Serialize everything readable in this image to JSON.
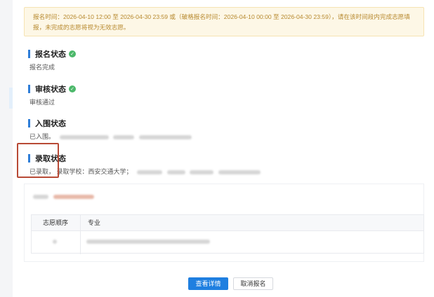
{
  "notice": {
    "text": "报名时间：2026-04-10 12:00 至 2026-04-30 23:59 或（破格报名时间：2026-04-10 00:00 至 2026-04-30 23:59），请在该时间段内完成志愿填报，未完成的志愿将视为无效志愿。"
  },
  "sections": {
    "registration": {
      "title": "报名状态",
      "status": "报名完成"
    },
    "review": {
      "title": "审核状态",
      "status": "审核通过"
    },
    "shortlist": {
      "title": "入围状态",
      "status": "已入围。"
    },
    "admission": {
      "title": "录取状态",
      "status_prefix": "已录取，",
      "school_label": "录取学校：西安交通大学；"
    }
  },
  "table": {
    "headers": [
      "志愿顺序",
      "专业"
    ]
  },
  "buttons": {
    "view_details": "查看详情",
    "cancel_registration": "取消报名"
  },
  "colors": {
    "accent": "#1f7fe0",
    "success": "#4cb86a",
    "notice_bg": "#fdf7e6",
    "highlight": "#b84a36"
  }
}
